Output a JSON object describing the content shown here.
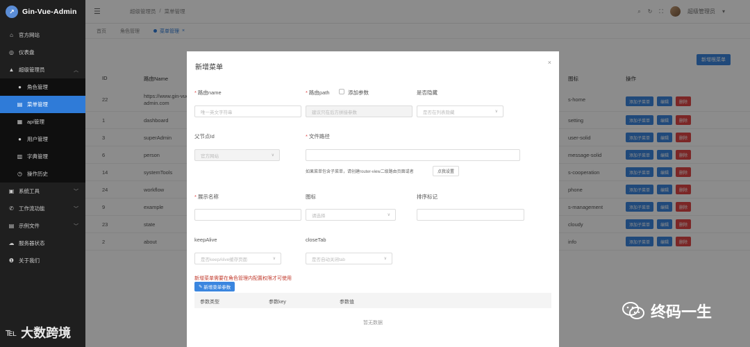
{
  "app": {
    "brand": "Gin-Vue-Admin"
  },
  "sidebar": {
    "items": [
      {
        "icon": "home-icon",
        "glyph": "⌂",
        "label": "官方网站"
      },
      {
        "icon": "dashboard-icon",
        "glyph": "◎",
        "label": "仪表盘"
      },
      {
        "icon": "user-icon",
        "glyph": "▲",
        "label": "超级管理员",
        "expanded": true
      }
    ],
    "sub_items": [
      {
        "icon": "user-icon",
        "glyph": "●",
        "label": "角色管理"
      },
      {
        "icon": "menu-icon",
        "glyph": "▤",
        "label": "菜单管理",
        "active": true
      },
      {
        "icon": "api-icon",
        "glyph": "▦",
        "label": "api管理"
      },
      {
        "icon": "user-icon",
        "glyph": "●",
        "label": "用户管理"
      },
      {
        "icon": "book-icon",
        "glyph": "▥",
        "label": "字典管理"
      },
      {
        "icon": "clock-icon",
        "glyph": "◷",
        "label": "操作历史"
      }
    ],
    "bottom_items": [
      {
        "icon": "tool-icon",
        "glyph": "▣",
        "label": "系统工具"
      },
      {
        "icon": "phone-icon",
        "glyph": "✆",
        "label": "工作流功能"
      },
      {
        "icon": "folder-icon",
        "glyph": "▤",
        "label": "示例文件"
      },
      {
        "icon": "cloud-icon",
        "glyph": "☁",
        "label": "服务器状态"
      },
      {
        "icon": "info-icon",
        "glyph": "❶",
        "label": "关于我们"
      }
    ]
  },
  "header": {
    "breadcrumb": [
      "超级管理员",
      "/",
      "菜单管理"
    ],
    "user_name": "超级管理员"
  },
  "tabs": [
    {
      "label": "首页"
    },
    {
      "label": "角色管理"
    },
    {
      "label": "菜单管理",
      "active": true
    }
  ],
  "main": {
    "add_root_label": "新增根菜单",
    "columns": {
      "id": "ID",
      "path": "路由Name",
      "icon": "图标",
      "ops": "操作"
    },
    "rows": [
      {
        "id": "22",
        "path": "https://www.gin-vue-admin.com",
        "icon": "s-home"
      },
      {
        "id": "1",
        "path": "dashboard",
        "icon": "setting"
      },
      {
        "id": "3",
        "path": "superAdmin",
        "icon": "user-solid"
      },
      {
        "id": "6",
        "path": "person",
        "icon": "message-solid"
      },
      {
        "id": "14",
        "path": "systemTools",
        "icon": "s-cooperation"
      },
      {
        "id": "24",
        "path": "workflow",
        "icon": "phone"
      },
      {
        "id": "9",
        "path": "example",
        "icon": "s-management"
      },
      {
        "id": "23",
        "path": "state",
        "icon": "cloudy"
      },
      {
        "id": "2",
        "path": "about",
        "icon": "info"
      }
    ],
    "btn_add_child": "添加子菜单",
    "btn_edit": "编辑",
    "btn_delete": "删除"
  },
  "dialog": {
    "title": "新增菜单",
    "close": "×",
    "route_name_label": "路由name",
    "route_name_placeholder": "唯一英文字符串",
    "route_path_label": "路由path",
    "add_param_label": "添加参数",
    "route_path_placeholder": "建议只在后方拼接参数",
    "hidden_label": "是否隐藏",
    "hidden_placeholder": "是否在列表隐藏",
    "parent_label": "父节点Id",
    "parent_value": "官方网站",
    "file_path_label": "文件路径",
    "file_hint": "如果菜单包含子菜单，请创建router-view二级路由页面或者",
    "file_hint_btn": "点我设置",
    "display_name_label": "展示名称",
    "icon_label": "图标",
    "icon_placeholder": "请选择",
    "sort_label": "排序标记",
    "keepalive_label": "keepAlive",
    "keepalive_placeholder": "是否keepAlive缓存页面",
    "closetab_label": "closeTab",
    "closetab_placeholder": "是否自动关闭tab",
    "warning": "新增菜单需要在角色管理内配置权限才可使用",
    "add_menu_param_btn": "新增菜单参数",
    "param_cols": [
      "参数类型",
      "参数key",
      "参数值"
    ],
    "no_data": "暂无数据"
  },
  "watermark": {
    "left_mark": "℡",
    "left_text": "大数跨境",
    "right_text": "终码一生"
  }
}
